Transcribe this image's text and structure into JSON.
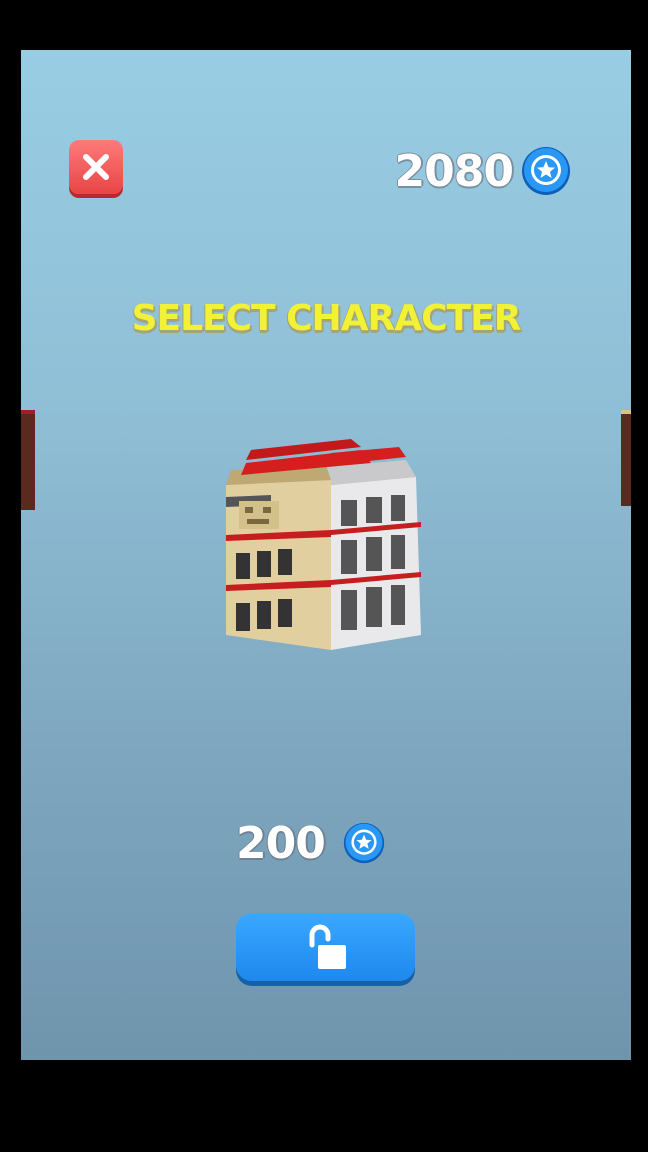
{
  "header": {
    "coin_balance": "2080",
    "close_icon": "close-x-icon",
    "coin_icon": "star-coin-icon"
  },
  "title": "SELECT CHARACTER",
  "character": {
    "icon": "voxel-building-character"
  },
  "price": {
    "value": "200",
    "icon": "star-coin-icon"
  },
  "unlock_button": {
    "icon": "unlock-padlock-icon"
  },
  "colors": {
    "close": "#e84545",
    "title": "#f1f136",
    "unlock": "#1e88ee",
    "coin": "#1f8ef0"
  }
}
